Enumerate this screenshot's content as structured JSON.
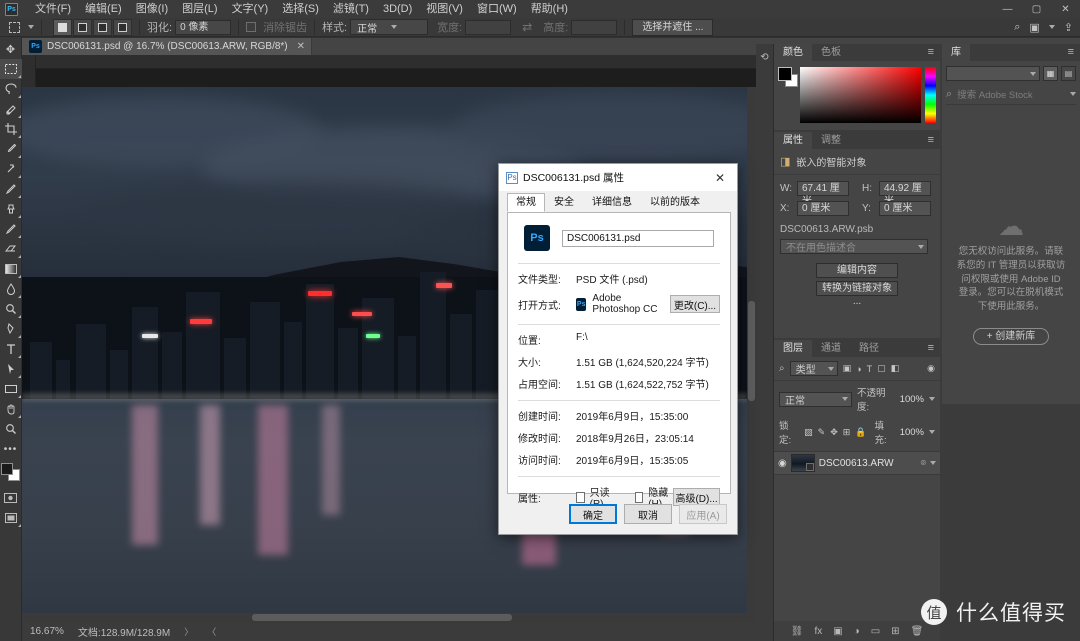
{
  "app": {
    "name": "Adobe Photoshop CC",
    "logo_text": "Ps"
  },
  "menubar": {
    "items": [
      {
        "label": "文件(F)"
      },
      {
        "label": "编辑(E)"
      },
      {
        "label": "图像(I)"
      },
      {
        "label": "图层(L)"
      },
      {
        "label": "文字(Y)"
      },
      {
        "label": "选择(S)"
      },
      {
        "label": "滤镜(T)"
      },
      {
        "label": "3D(D)"
      },
      {
        "label": "视图(V)"
      },
      {
        "label": "窗口(W)"
      },
      {
        "label": "帮助(H)"
      }
    ],
    "window_controls": {
      "minimize": "—",
      "maximize": "▢",
      "close": "✕"
    }
  },
  "optionsbar": {
    "feather_label": "羽化:",
    "feather_value": "0 像素",
    "antialias_label": "消除锯齿",
    "style_label": "样式:",
    "style_value": "正常",
    "width_label": "宽度:",
    "width_value": "",
    "height_label": "高度:",
    "height_value": "",
    "swap_icon": "⇄",
    "select_mask_button": "选择并遮住 ..."
  },
  "topright": {
    "search_icon": "search-icon",
    "arrange_icon": "arrange-documents-icon",
    "share_icon": "share-icon"
  },
  "document": {
    "tab_title": "DSC006131.psd @ 16.7% (DSC00613.ARW, RGB/8*)",
    "close_glyph": "✕"
  },
  "statusbar": {
    "zoom": "16.67%",
    "doc_size": "文档:128.9M/128.9M",
    "arrow": "〉",
    "caret": "〈"
  },
  "toolbar": {
    "tools": [
      {
        "name": "move-tool",
        "glyph": "✥"
      },
      {
        "name": "rectangular-marquee-tool",
        "glyph": "▭",
        "selected": true
      },
      {
        "name": "lasso-tool",
        "glyph": "◯"
      },
      {
        "name": "quick-selection-tool",
        "glyph": "✎"
      },
      {
        "name": "crop-tool",
        "glyph": "⌗"
      },
      {
        "name": "eyedropper-tool",
        "glyph": "✒"
      },
      {
        "name": "spot-healing-brush-tool",
        "glyph": "✤"
      },
      {
        "name": "brush-tool",
        "glyph": "✏"
      },
      {
        "name": "clone-stamp-tool",
        "glyph": "⚑"
      },
      {
        "name": "history-brush-tool",
        "glyph": "✐"
      },
      {
        "name": "eraser-tool",
        "glyph": "◨"
      },
      {
        "name": "gradient-tool",
        "glyph": "▥"
      },
      {
        "name": "blur-tool",
        "glyph": "💧"
      },
      {
        "name": "dodge-tool",
        "glyph": "●"
      },
      {
        "name": "pen-tool",
        "glyph": "✎"
      },
      {
        "name": "horizontal-type-tool",
        "glyph": "T"
      },
      {
        "name": "path-selection-tool",
        "glyph": "➤"
      },
      {
        "name": "rectangle-tool",
        "glyph": "▬"
      },
      {
        "name": "hand-tool",
        "glyph": "✋"
      },
      {
        "name": "zoom-tool",
        "glyph": "🔍"
      },
      {
        "name": "edit-toolbar-tool",
        "glyph": "⋯"
      }
    ],
    "foreground_color": "#000000",
    "background_color": "#ffffff"
  },
  "color_panel": {
    "tabs": [
      {
        "label": "颜色",
        "active": true
      },
      {
        "label": "色板",
        "active": false
      }
    ],
    "menu_glyph": "≡"
  },
  "libraries_panel": {
    "tabs": [
      {
        "label": "库",
        "active": true
      }
    ],
    "menu_glyph": "≡",
    "search_placeholder": "搜索 Adobe Stock",
    "grid_icon": "grid-view-icon",
    "list_icon": "list-view-icon",
    "offline_message": "您无权访问此服务。请联系您的 IT 管理员以获取访问权限或使用 Adobe ID 登录。您可以在脱机模式下使用此服务。",
    "create_library_button": "+ 创建新库"
  },
  "properties_panel": {
    "tabs": [
      {
        "label": "属性",
        "active": true
      },
      {
        "label": "调整",
        "active": false
      }
    ],
    "menu_glyph": "≡",
    "object_type": "嵌入的智能对象",
    "fields": [
      {
        "label": "W:",
        "value": "67.41 厘米"
      },
      {
        "label": "H:",
        "value": "44.92 厘米"
      },
      {
        "label": "X:",
        "value": "0 厘米"
      },
      {
        "label": "Y:",
        "value": "0 厘米"
      }
    ],
    "filename": "DSC00613.ARW.psb",
    "profile_placeholder": "不在用色描述合",
    "buttons": [
      "编辑内容",
      "转换为链接对象 ..."
    ]
  },
  "layers_panel": {
    "tabs": [
      {
        "label": "图层",
        "active": true
      },
      {
        "label": "通道",
        "active": false
      },
      {
        "label": "路径",
        "active": false
      }
    ],
    "menu_glyph": "≡",
    "filter_label": "类型",
    "filter_icons": [
      "image-filter-icon",
      "adjustment-filter-icon",
      "type-filter-icon",
      "shape-filter-icon",
      "smart-object-filter-icon"
    ],
    "blend_mode": "正常",
    "opacity_label": "不透明度:",
    "opacity_value": "100%",
    "lock_label": "锁定:",
    "lock_icons": [
      "lock-transparent-pixels-icon",
      "lock-image-pixels-icon",
      "lock-position-icon",
      "lock-artboard-icon",
      "lock-all-icon"
    ],
    "fill_label": "填充:",
    "fill_value": "100%",
    "layers": [
      {
        "name": "DSC00613.ARW",
        "visible": true,
        "eye_icon": "eye-icon",
        "link_icon": "smart-object-badge-icon"
      }
    ],
    "bottom_icons": [
      "link-layers-icon",
      "layer-style-icon",
      "layer-mask-icon",
      "adjustment-layer-icon",
      "new-group-icon",
      "new-layer-icon",
      "delete-layer-icon"
    ]
  },
  "dialog": {
    "title": "DSC006131.psd 属性",
    "icon": "Ps",
    "close_glyph": "✕",
    "tabs": [
      {
        "label": "常规",
        "active": true
      },
      {
        "label": "安全",
        "active": false
      },
      {
        "label": "详细信息",
        "active": false
      },
      {
        "label": "以前的版本",
        "active": false
      }
    ],
    "filename": "DSC006131.psd",
    "rows": [
      {
        "label": "文件类型:",
        "value": "PSD 文件 (.psd)"
      },
      {
        "label": "位置:",
        "value": "F:\\"
      },
      {
        "label": "大小:",
        "value": "1.51 GB (1,624,520,224 字节)"
      },
      {
        "label": "占用空间:",
        "value": "1.51 GB (1,624,522,752 字节)"
      },
      {
        "label": "创建时间:",
        "value": "2019年6月9日，15:35:00"
      },
      {
        "label": "修改时间:",
        "value": "2018年9月26日，23:05:14"
      },
      {
        "label": "访问时间:",
        "value": "2019年6月9日，15:35:05"
      }
    ],
    "open_with": {
      "label": "打开方式:",
      "app": "Adobe Photoshop CC",
      "change_button": "更改(C)..."
    },
    "attributes": {
      "label": "属性:",
      "readonly": "只读(R)",
      "hidden": "隐藏(H)",
      "advanced_button": "高级(D)..."
    },
    "footer": {
      "ok": "确定",
      "cancel": "取消",
      "apply": "应用(A)"
    }
  },
  "watermark": {
    "badge": "值",
    "text": "什么值得买"
  }
}
